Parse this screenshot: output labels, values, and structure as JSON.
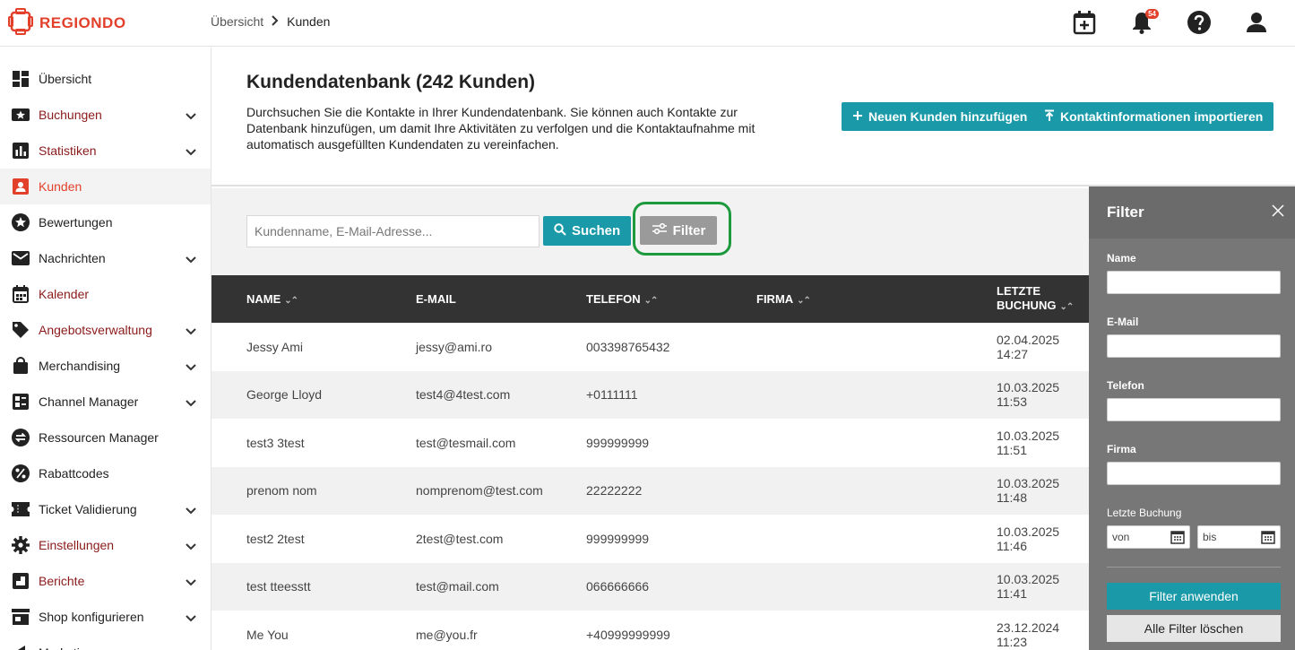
{
  "brand": {
    "name": "REGIONDO",
    "accent": "#e2402b",
    "teal": "#1a9aa8"
  },
  "breadcrumb": {
    "root": "Übersicht",
    "current": "Kunden"
  },
  "topbar": {
    "notification_count": "54",
    "icons": [
      "calendar-plus-icon",
      "bell-icon",
      "help-icon",
      "user-icon"
    ]
  },
  "sidebar": {
    "items": [
      {
        "label": "Übersicht",
        "icon": "dashboard-icon",
        "expandable": false
      },
      {
        "label": "Buchungen",
        "icon": "star-ticket-icon",
        "expandable": true
      },
      {
        "label": "Statistiken",
        "icon": "bar-chart-icon",
        "expandable": true
      },
      {
        "label": "Kunden",
        "icon": "person-icon",
        "expandable": false,
        "active": true
      },
      {
        "label": "Bewertungen",
        "icon": "star-icon",
        "expandable": false
      },
      {
        "label": "Nachrichten",
        "icon": "mail-icon",
        "expandable": true
      },
      {
        "label": "Kalender",
        "icon": "calendar-icon",
        "expandable": false
      },
      {
        "label": "Angebotsverwaltung",
        "icon": "tag-icon",
        "expandable": true
      },
      {
        "label": "Merchandising",
        "icon": "bag-icon",
        "expandable": true
      },
      {
        "label": "Channel Manager",
        "icon": "channel-icon",
        "expandable": true
      },
      {
        "label": "Ressourcen Manager",
        "icon": "swap-icon",
        "expandable": false
      },
      {
        "label": "Rabattcodes",
        "icon": "percent-icon",
        "expandable": false
      },
      {
        "label": "Ticket Validierung",
        "icon": "ticket-icon",
        "expandable": true
      },
      {
        "label": "Einstellungen",
        "icon": "gear-icon",
        "expandable": true
      },
      {
        "label": "Berichte",
        "icon": "report-icon",
        "expandable": true
      },
      {
        "label": "Shop konfigurieren",
        "icon": "shop-icon",
        "expandable": true
      },
      {
        "label": "Marketing",
        "icon": "megaphone-icon",
        "expandable": true
      }
    ]
  },
  "page": {
    "title": "Kundendatenbank (242 Kunden)",
    "description": "Durchsuchen Sie die Kontakte in Ihrer Kundendatenbank. Sie können auch Kontakte zur Datenbank hinzufügen, um damit Ihre Aktivitäten zu verfolgen und die Kontaktaufnahme mit automatisch ausgefüllten Kundendaten zu vereinfachen.",
    "add_button": "Neuen Kunden hinzufügen",
    "import_button": "Kontaktinformationen importieren"
  },
  "search": {
    "placeholder": "Kundenname, E-Mail-Adresse...",
    "value": "",
    "search_button": "Suchen",
    "filter_button": "Filter"
  },
  "table": {
    "headers": {
      "name": "NAME",
      "email": "E-MAIL",
      "phone": "TELEFON",
      "company": "FIRMA",
      "last_booking_1": "LETZTE",
      "last_booking_2": "BUCHUNG"
    },
    "rows": [
      {
        "name": "Jessy Ami",
        "email": "jessy@ami.ro",
        "phone": "003398765432",
        "company": "",
        "date": "02.04.2025",
        "time": "14:27"
      },
      {
        "name": "George Lloyd",
        "email": "test4@4test.com",
        "phone": "+0111111",
        "company": "",
        "date": "10.03.2025",
        "time": "11:53"
      },
      {
        "name": "test3 3test",
        "email": "test@tesmail.com",
        "phone": "999999999",
        "company": "",
        "date": "10.03.2025",
        "time": "11:51"
      },
      {
        "name": "prenom nom",
        "email": "nomprenom@test.com",
        "phone": "22222222",
        "company": "",
        "date": "10.03.2025",
        "time": "11:48"
      },
      {
        "name": "test2 2test",
        "email": "2test@test.com",
        "phone": "999999999",
        "company": "",
        "date": "10.03.2025",
        "time": "11:46"
      },
      {
        "name": "test tteesstt",
        "email": "test@mail.com",
        "phone": "066666666",
        "company": "",
        "date": "10.03.2025",
        "time": "11:41"
      },
      {
        "name": "Me You",
        "email": "me@you.fr",
        "phone": "+40999999999",
        "company": "",
        "date": "23.12.2024",
        "time": "11:23"
      }
    ]
  },
  "filter_panel": {
    "title": "Filter",
    "name_label": "Name",
    "email_label": "E-Mail",
    "phone_label": "Telefon",
    "company_label": "Firma",
    "last_booking_label": "Letzte Buchung",
    "from_placeholder": "von",
    "to_placeholder": "bis",
    "apply_button": "Filter anwenden",
    "clear_button": "Alle Filter löschen"
  }
}
